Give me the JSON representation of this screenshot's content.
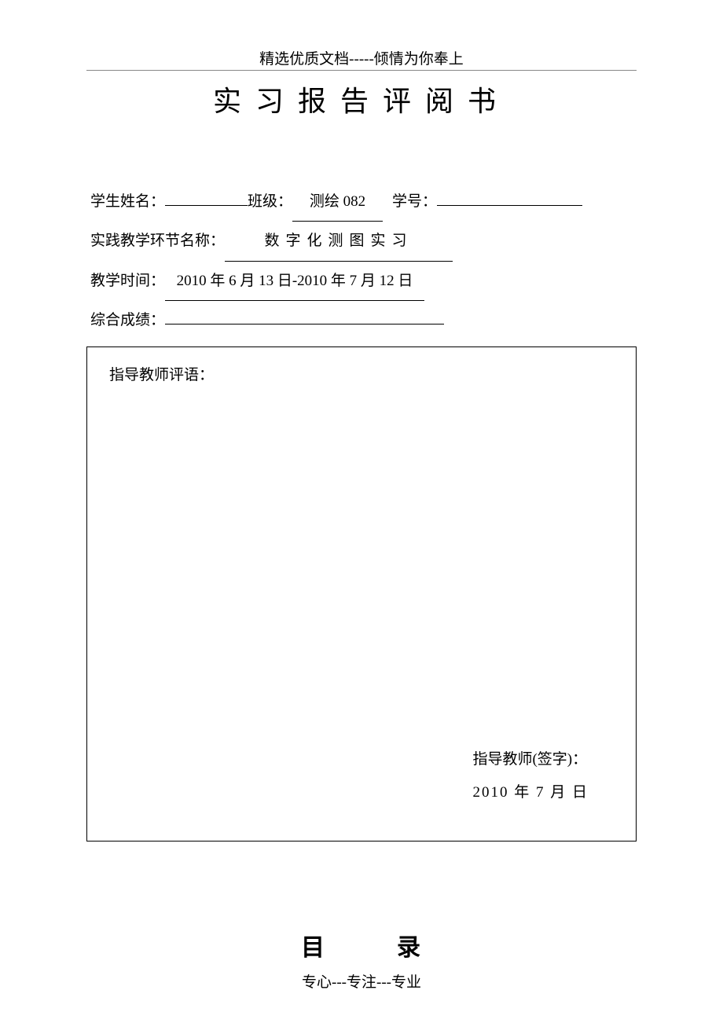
{
  "header": "精选优质文档-----倾情为你奉上",
  "title": "实习报告评阅书",
  "fields": {
    "student_name_label": "学生姓名：",
    "student_name_value": "",
    "class_label": "班级：",
    "class_value": "测绘 082",
    "sid_label": "学号：",
    "sid_value": "",
    "course_label": "实践教学环节名称：",
    "course_value": "数字化测图实习",
    "time_label": "教学时间：",
    "time_value": "2010 年 6 月 13 日-2010 年 7 月 12 日",
    "score_label": "综合成绩：",
    "score_value": ""
  },
  "comment": {
    "label": "指导教师评语：",
    "signature_label": "指导教师(签字)：",
    "date_text": "2010 年  7 月   日"
  },
  "toc": {
    "mu": "目",
    "lu": "录"
  },
  "footer": "专心---专注---专业"
}
